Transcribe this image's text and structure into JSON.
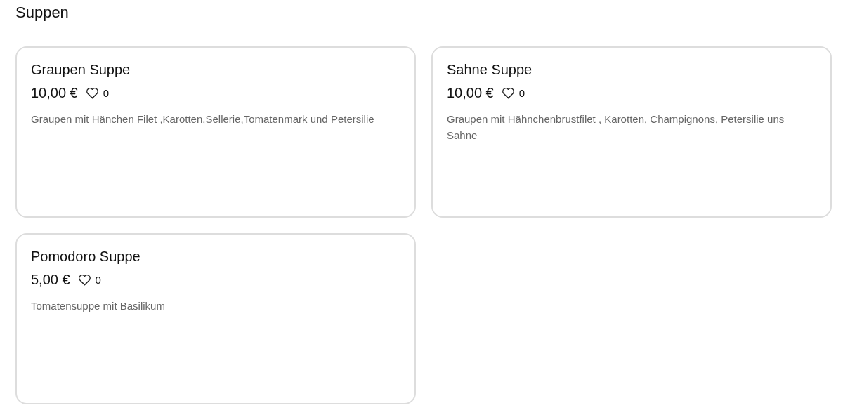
{
  "section": {
    "title": "Suppen"
  },
  "dishes": [
    {
      "name": "Graupen Suppe",
      "price": "10,00 €",
      "likes": "0",
      "description": "Graupen mit Hänchen Filet ,Karotten,Sellerie,Tomatenmark und Petersilie"
    },
    {
      "name": "Sahne Suppe",
      "price": "10,00 €",
      "likes": "0",
      "description": "Graupen mit Hähnchenbrustfilet , Karotten, Champignons, Petersilie uns Sahne"
    },
    {
      "name": "Pomodoro Suppe",
      "price": "5,00 €",
      "likes": "0",
      "description": "Tomatensuppe mit Basilikum"
    }
  ]
}
